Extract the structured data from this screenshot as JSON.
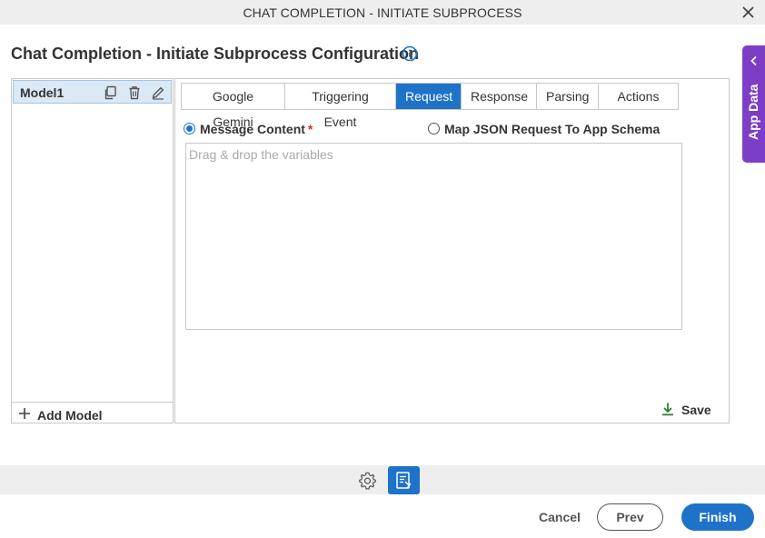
{
  "window": {
    "title": "CHAT COMPLETION - INITIATE SUBPROCESS",
    "close_icon": "close-icon"
  },
  "page": {
    "title": "Chat Completion - Initiate Subprocess Configuration",
    "info_icon": "info-icon"
  },
  "app_data": {
    "label": "App Data",
    "icon": "chevron-left-icon",
    "color": "#7c3ec7"
  },
  "models": {
    "items": [
      {
        "label": "Model1",
        "selected": true
      }
    ],
    "item_actions": [
      "copy-icon",
      "delete-icon",
      "edit-icon"
    ],
    "add_label": "Add Model"
  },
  "tabs": [
    {
      "label": "Google Gemini",
      "active": false
    },
    {
      "label": "Triggering Event",
      "active": false
    },
    {
      "label": "Request",
      "active": true
    },
    {
      "label": "Response",
      "active": false
    },
    {
      "label": "Parsing",
      "active": false
    },
    {
      "label": "Actions",
      "active": false
    }
  ],
  "request": {
    "options": [
      {
        "label": "Message Content",
        "required": true,
        "checked": true
      },
      {
        "label": "Map JSON Request To App Schema",
        "required": false,
        "checked": false
      }
    ],
    "required_marker": "*",
    "drop_placeholder": "Drag & drop the variables",
    "save_label": "Save"
  },
  "toolbar": {
    "icons": [
      "gear-icon",
      "app-form-icon"
    ]
  },
  "footer": {
    "cancel_label": "Cancel",
    "prev_label": "Prev",
    "finish_label": "Finish"
  },
  "colors": {
    "accent": "#1e73c8",
    "purple": "#7c3ec7",
    "required": "#d32f2f",
    "save_icon": "#2e7d32"
  }
}
